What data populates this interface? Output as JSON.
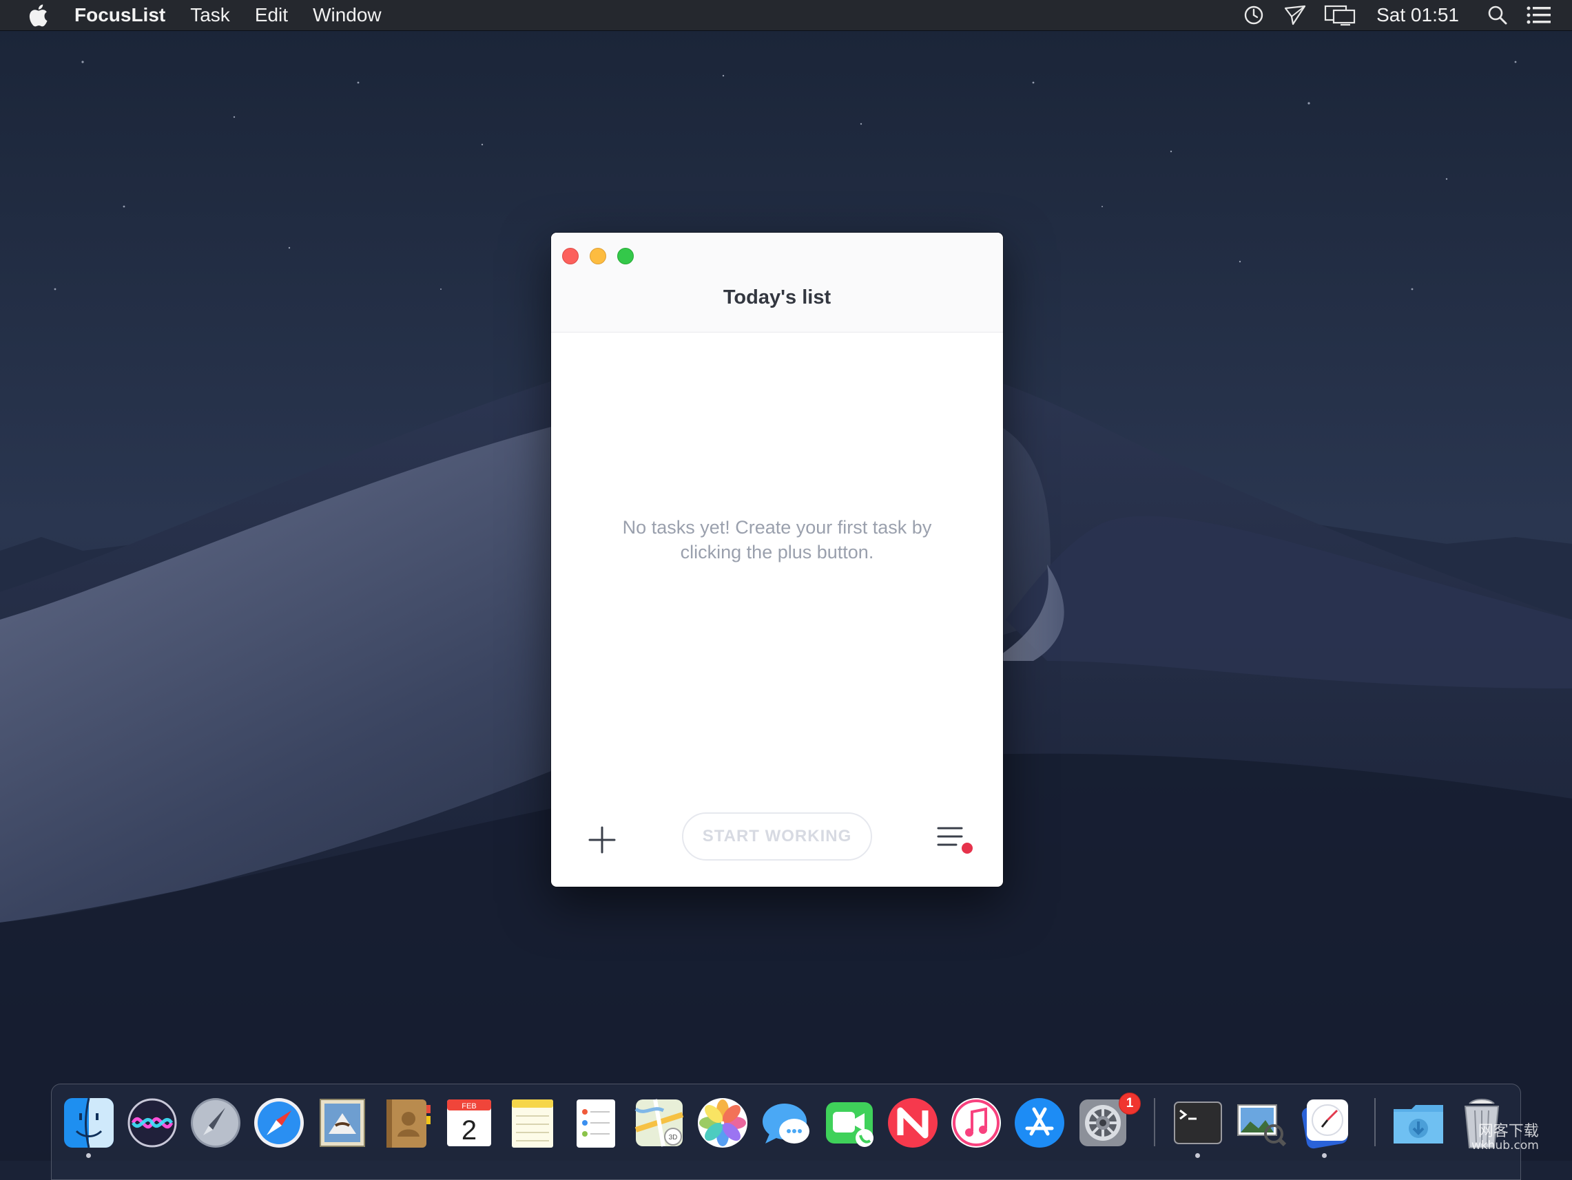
{
  "menubar": {
    "app_name": "FocusList",
    "menus": [
      "Task",
      "Edit",
      "Window"
    ],
    "clock": "Sat 01:51",
    "status_icons": [
      "time-machine-icon",
      "airdrop-icon",
      "display-mirroring-icon",
      "spotlight-search-icon",
      "notification-center-icon"
    ]
  },
  "window": {
    "title": "Today's list",
    "empty_message": "No tasks yet! Create your first task by clicking the plus button.",
    "start_button": "START WORKING",
    "add_icon": "plus-icon",
    "menu_icon": "list-menu-icon",
    "notification_dot_color": "#e6324b"
  },
  "dock": {
    "apps": [
      "Finder",
      "Siri",
      "Launchpad",
      "Safari",
      "Mail",
      "Contacts",
      "Calendar",
      "Notes",
      "Reminders",
      "Maps",
      "Photos",
      "Messages",
      "FaceTime",
      "News",
      "iTunes",
      "App Store",
      "System Preferences",
      "Terminal",
      "Preview",
      "FocusList",
      "Downloads",
      "Trash"
    ],
    "calendar_month": "FEB",
    "calendar_day": "2",
    "system_prefs_badge": "1"
  },
  "watermark": {
    "line1": "网客下载",
    "line2": "wkhub.com"
  }
}
